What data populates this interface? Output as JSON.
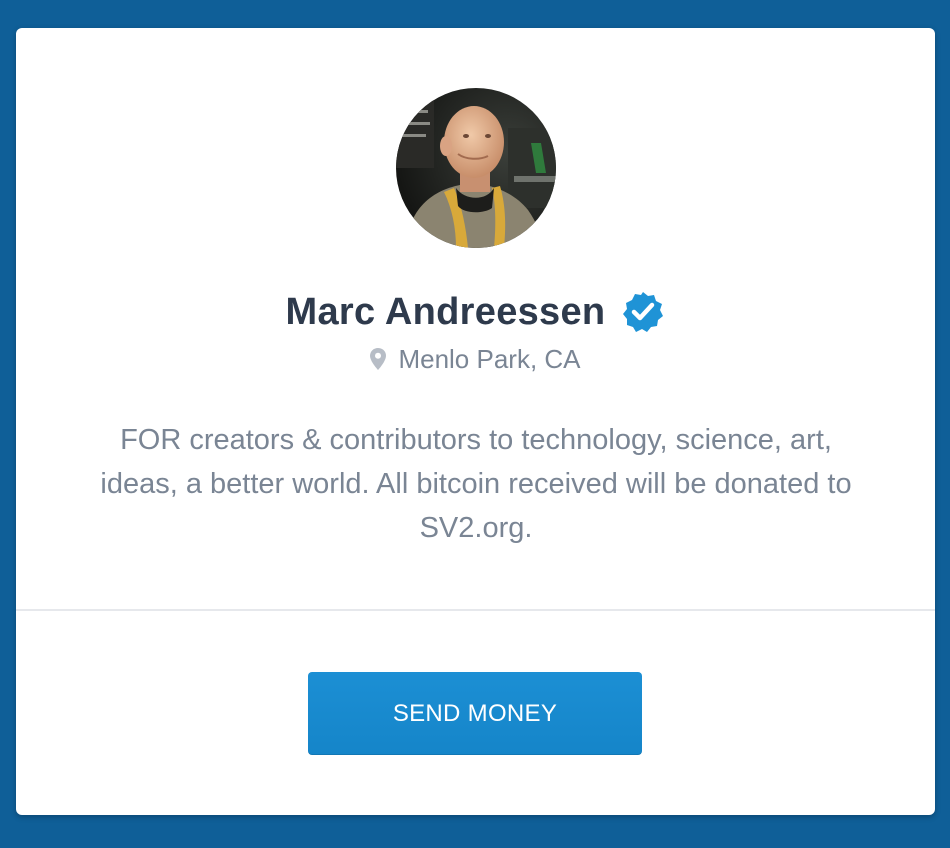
{
  "profile": {
    "name": "Marc Andreessen",
    "verified": true,
    "location": "Menlo Park, CA",
    "bio": "FOR creators & contributors to technology, science, art, ideas, a better world. All bitcoin received will be donated to SV2.org."
  },
  "actions": {
    "send_money_label": "SEND MONEY"
  },
  "icons": {
    "verified": "verified-badge-icon",
    "location": "map-pin-icon"
  },
  "colors": {
    "page_background": "#0f5f98",
    "card_background": "#ffffff",
    "name_text": "#2e3a4c",
    "muted_text": "#7a8594",
    "verified_badge": "#1f93d6",
    "button_background": "#1789cd",
    "button_text": "#ffffff"
  }
}
